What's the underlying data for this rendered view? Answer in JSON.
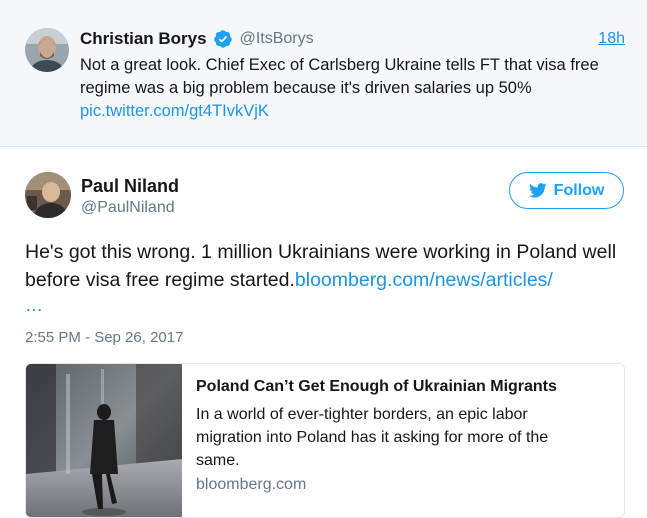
{
  "quoted_tweet": {
    "author_name": "Christian Borys",
    "author_handle": "@ItsBorys",
    "time": "18h",
    "text": "Not a great look. Chief Exec of Carlsberg Ukraine tells FT that visa free regime was a big problem because it's driven salaries up 50%",
    "link": "pic.twitter.com/gt4TIvkVjK"
  },
  "tweet": {
    "author_name": "Paul Niland",
    "author_handle": "@PaulNiland",
    "follow_label": "Follow",
    "text": "He's got this wrong. 1 million Ukrainians were working in Poland well before visa free regime started.",
    "link": "bloomberg.com/news/articles/",
    "link_ellipsis": "…",
    "timestamp": "2:55 PM - Sep 26, 2017"
  },
  "card": {
    "title": "Poland Can’t Get Enough of Ukrainian Migrants",
    "description": "In a world of ever-tighter borders, an epic labor migration into Poland has it asking for more of the same.",
    "domain": "bloomberg.com"
  },
  "colors": {
    "link": "#1b95e0",
    "follow": "#1da1f2",
    "muted": "#657786",
    "quoted_background": "#f5f8fa"
  },
  "icons": {
    "verified": "verified-badge-icon",
    "follow": "twitter-bird-icon"
  }
}
